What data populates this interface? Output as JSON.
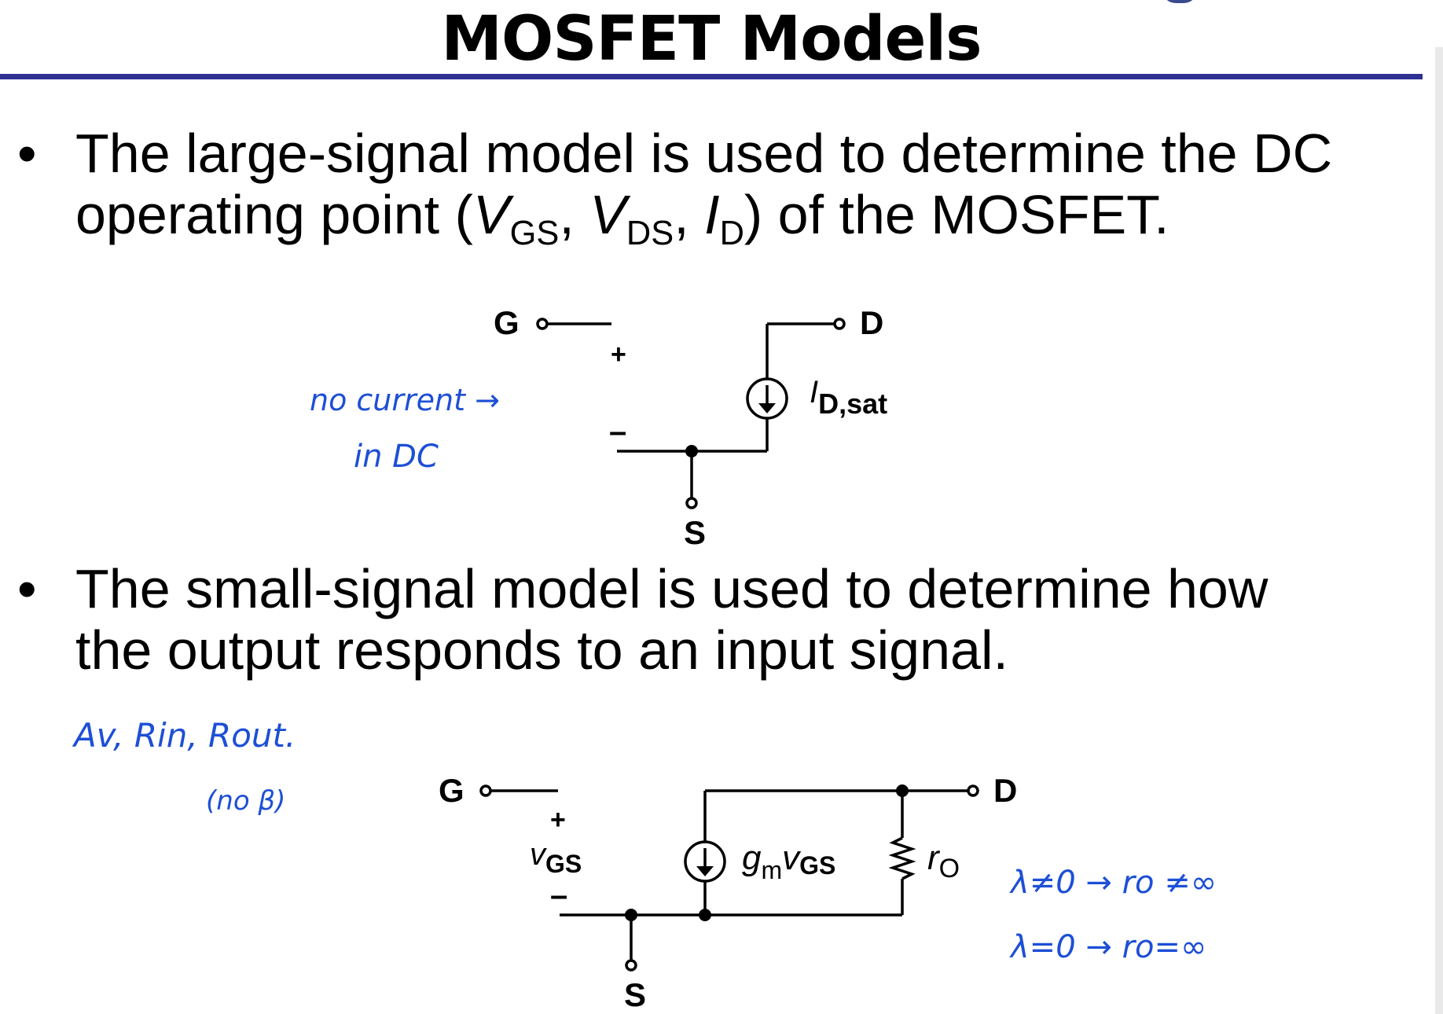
{
  "slide": {
    "title": "MOSFET Models",
    "bullets": [
      {
        "bullet_glyph": "•",
        "line1": "The large-signal model is used to determine the DC",
        "line2_prefix": "operating point (",
        "vgs_main": "V",
        "vgs_sub": "GS",
        "sep1": ", ",
        "vds_main": "V",
        "vds_sub": "DS",
        "sep2": ", ",
        "id_main": "I",
        "id_sub": "D",
        "line2_suffix": ") of the MOSFET."
      },
      {
        "bullet_glyph": "•",
        "line1": "The small-signal model is used to determine how",
        "line2": "the output responds to an input signal."
      }
    ]
  },
  "large_signal_circuit": {
    "gate_label": "G",
    "drain_label": "D",
    "source_label": "S",
    "plus": "+",
    "minus": "–",
    "current_main": "I",
    "current_sub": "D,sat"
  },
  "small_signal_circuit": {
    "gate_label": "G",
    "drain_label": "D",
    "source_label": "S",
    "plus": "+",
    "minus": "–",
    "vgs_main": "v",
    "vgs_sub": "GS",
    "gm_main": "g",
    "gm_sub": "m",
    "gm_v": "v",
    "gm_vsub": "GS",
    "ro_main": "r",
    "ro_sub": "O"
  },
  "handwritten_notes": {
    "color": "#1d4fd6",
    "note1_line1": "no current →",
    "note1_line2": "in DC",
    "note2_line1": "Av, Rin, Rout.",
    "note2_line2": "(no β)",
    "note3_line1": "λ≠0 → ro ≠∞",
    "note3_line2": "λ=0 → ro=∞"
  },
  "colors": {
    "title_rule": "#2e3192",
    "text": "#000000"
  }
}
